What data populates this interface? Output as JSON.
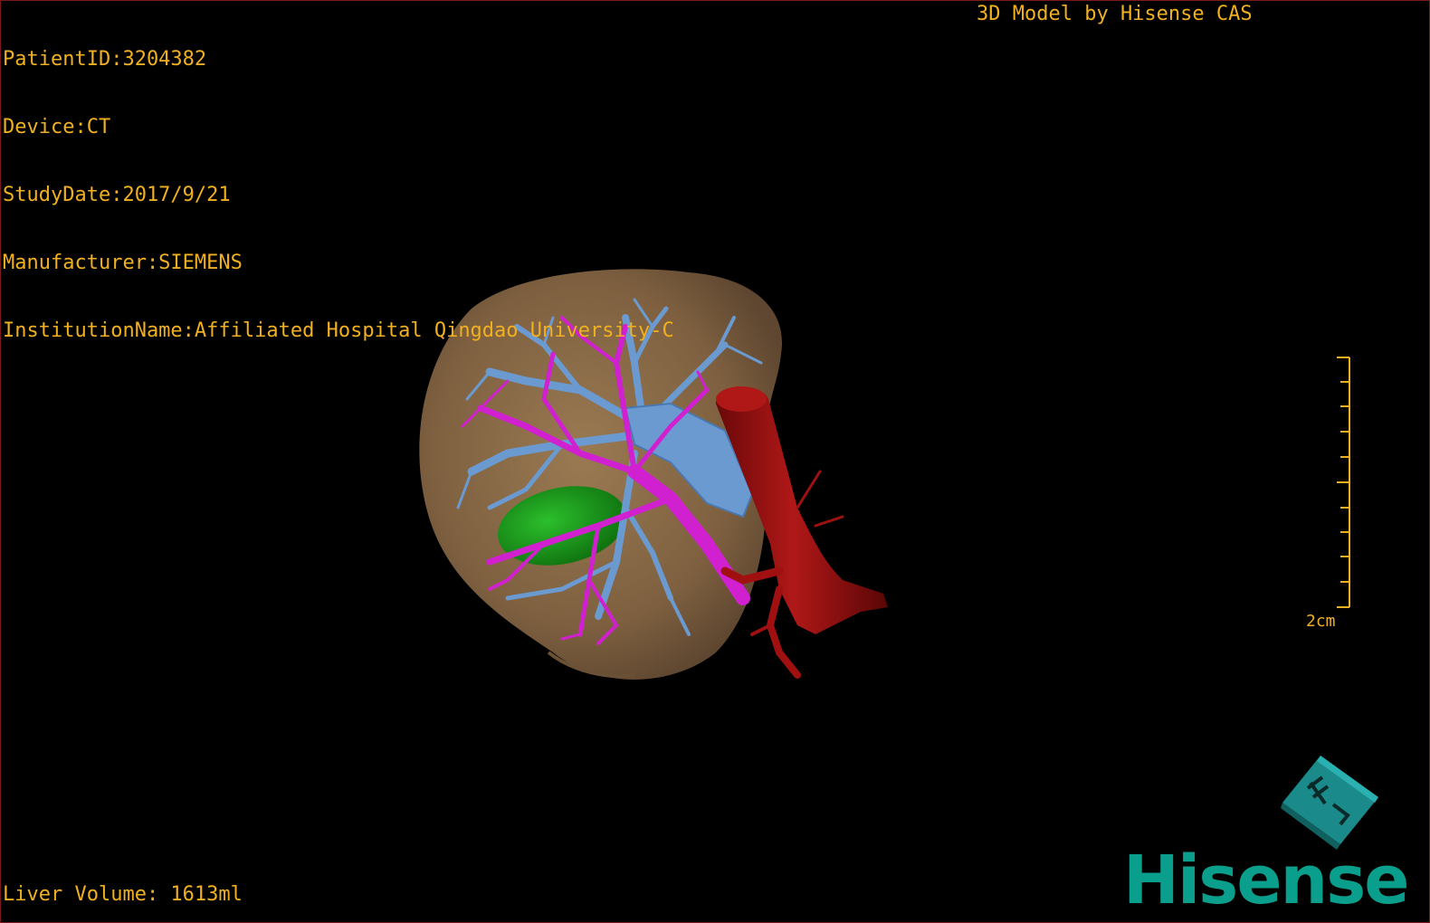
{
  "overlay": {
    "patient_id": "PatientID:3204382",
    "device": "Device:CT",
    "study_date": "StudyDate:2017/9/21",
    "manufacturer": "Manufacturer:SIEMENS",
    "institution": "InstitutionName:Affiliated Hospital Qingdao University-C",
    "credit": "3D Model by Hisense CAS",
    "liver_volume": "Liver Volume: 1613ml"
  },
  "scale": {
    "label": "2cm"
  },
  "logo": {
    "brand": "Hisense",
    "cube_icon": "orientation-cube-icon"
  },
  "colors": {
    "overlay_text": "#f0b020",
    "liver": "#8a6a45",
    "hepatic_vein": "#6a9ad0",
    "portal_vein": "#d020d0",
    "aorta": "#a01010",
    "gallbladder": "#1a9a1a",
    "brand": "#0a9e8c"
  }
}
